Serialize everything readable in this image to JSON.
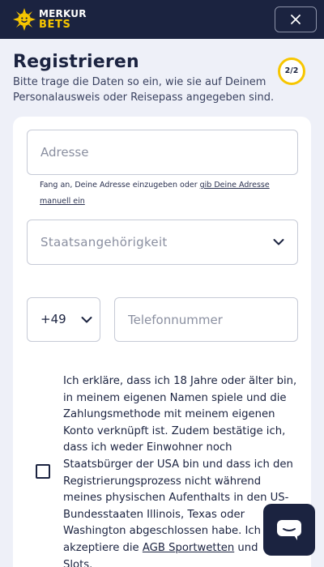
{
  "header": {
    "brand_top": "MERKUR",
    "brand_bottom": "BETS",
    "close_icon": "close-icon",
    "colors": {
      "background": "#1b2340",
      "brand_yellow": "#f7c600"
    }
  },
  "page": {
    "title": "Registrieren",
    "subtitle": "Bitte trage die Daten so ein, wie sie auf Deinem Personalausweis oder Reisepass angegeben sind.",
    "step": "2/2",
    "step_progress": 1.0
  },
  "form": {
    "address": {
      "placeholder": "Adresse",
      "value": ""
    },
    "address_hint": {
      "text": "Fang an, Deine Adresse einzugeben oder ",
      "link": "gib Deine Adresse manuell ein"
    },
    "nationality": {
      "placeholder": "Staatsangehörigkeit",
      "icon": "chevron-down-icon"
    },
    "phone_prefix": {
      "value": "+49",
      "icon": "chevron-down-icon"
    },
    "phone": {
      "placeholder": "Telefonnummer",
      "value": ""
    },
    "consent": {
      "checked": false,
      "text": "Ich erkläre, dass ich 18 Jahre oder älter bin, in meinem eigenen Namen spiele und die Zahlungsmethode mit meinem eigenen Konto verknüpft ist. Zudem bestätige ich, dass ich weder Einwohner noch Staatsbürger der USA bin und dass ich den Registrierungsprozess nicht während meines physischen Aufenthalts in den US-Bundesstaaten Illinois, Texas oder Washington abgeschlossen habe. Ich akzeptiere die ",
      "link": "AGB Sportwetten",
      "text_after": " und",
      "text_end": "Slots."
    }
  },
  "chat": {
    "icon": "chat-icon"
  }
}
